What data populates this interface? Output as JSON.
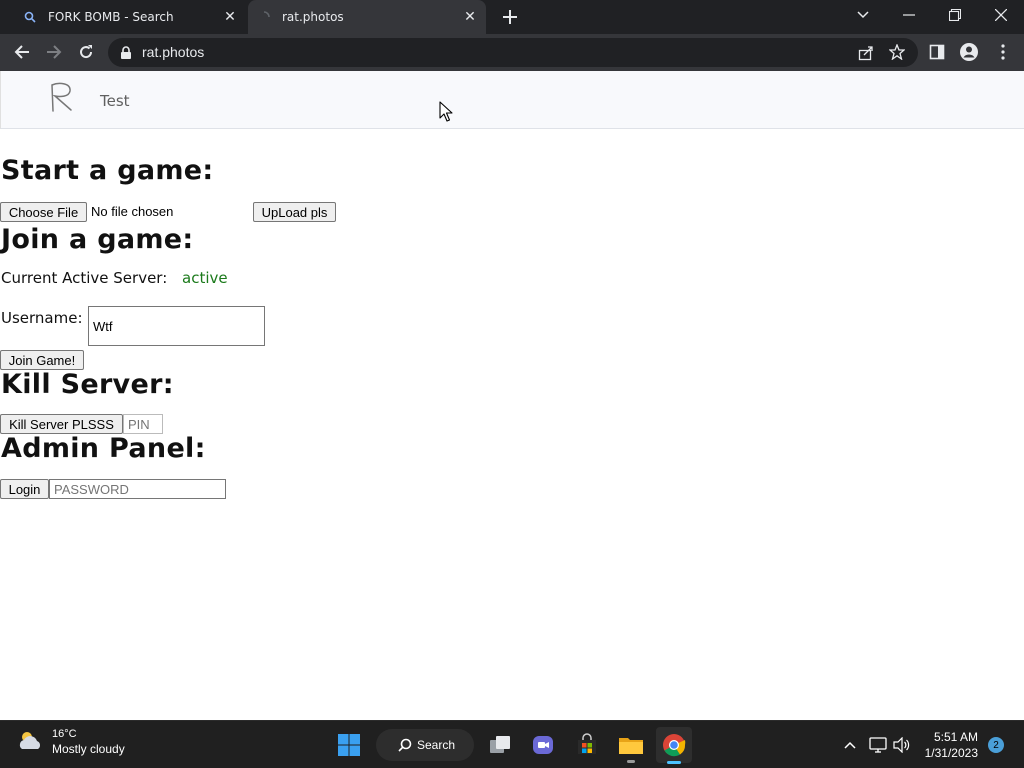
{
  "browser": {
    "tabs": [
      {
        "title": "FORK BOMB - Search",
        "active": false,
        "favicon": "search-icon"
      },
      {
        "title": "rat.photos",
        "active": true,
        "favicon": "loading-icon"
      }
    ],
    "url": "rat.photos"
  },
  "site": {
    "logo_letter": "R",
    "nav_link": "Test"
  },
  "start_game": {
    "heading": "Start a game:",
    "choose_file_label": "Choose File",
    "file_status": "No file chosen",
    "upload_label": "UpLoad pls"
  },
  "join_game": {
    "heading": "Join a game:",
    "server_label": "Current Active Server:",
    "server_status": "active",
    "server_status_color": "#1b7a1b",
    "username_label": "Username:",
    "username_value": "Wtf",
    "join_label": "Join Game!"
  },
  "kill_server": {
    "heading": "Kill Server:",
    "button_label": "Kill Server PLSSS",
    "pin_placeholder": "PIN"
  },
  "admin": {
    "heading": "Admin Panel:",
    "login_label": "Login",
    "password_placeholder": "PASSWORD"
  },
  "taskbar": {
    "weather_temp": "16°C",
    "weather_condition": "Mostly cloudy",
    "search_label": "Search",
    "time": "5:51 AM",
    "date": "1/31/2023",
    "notification_count": "2"
  }
}
